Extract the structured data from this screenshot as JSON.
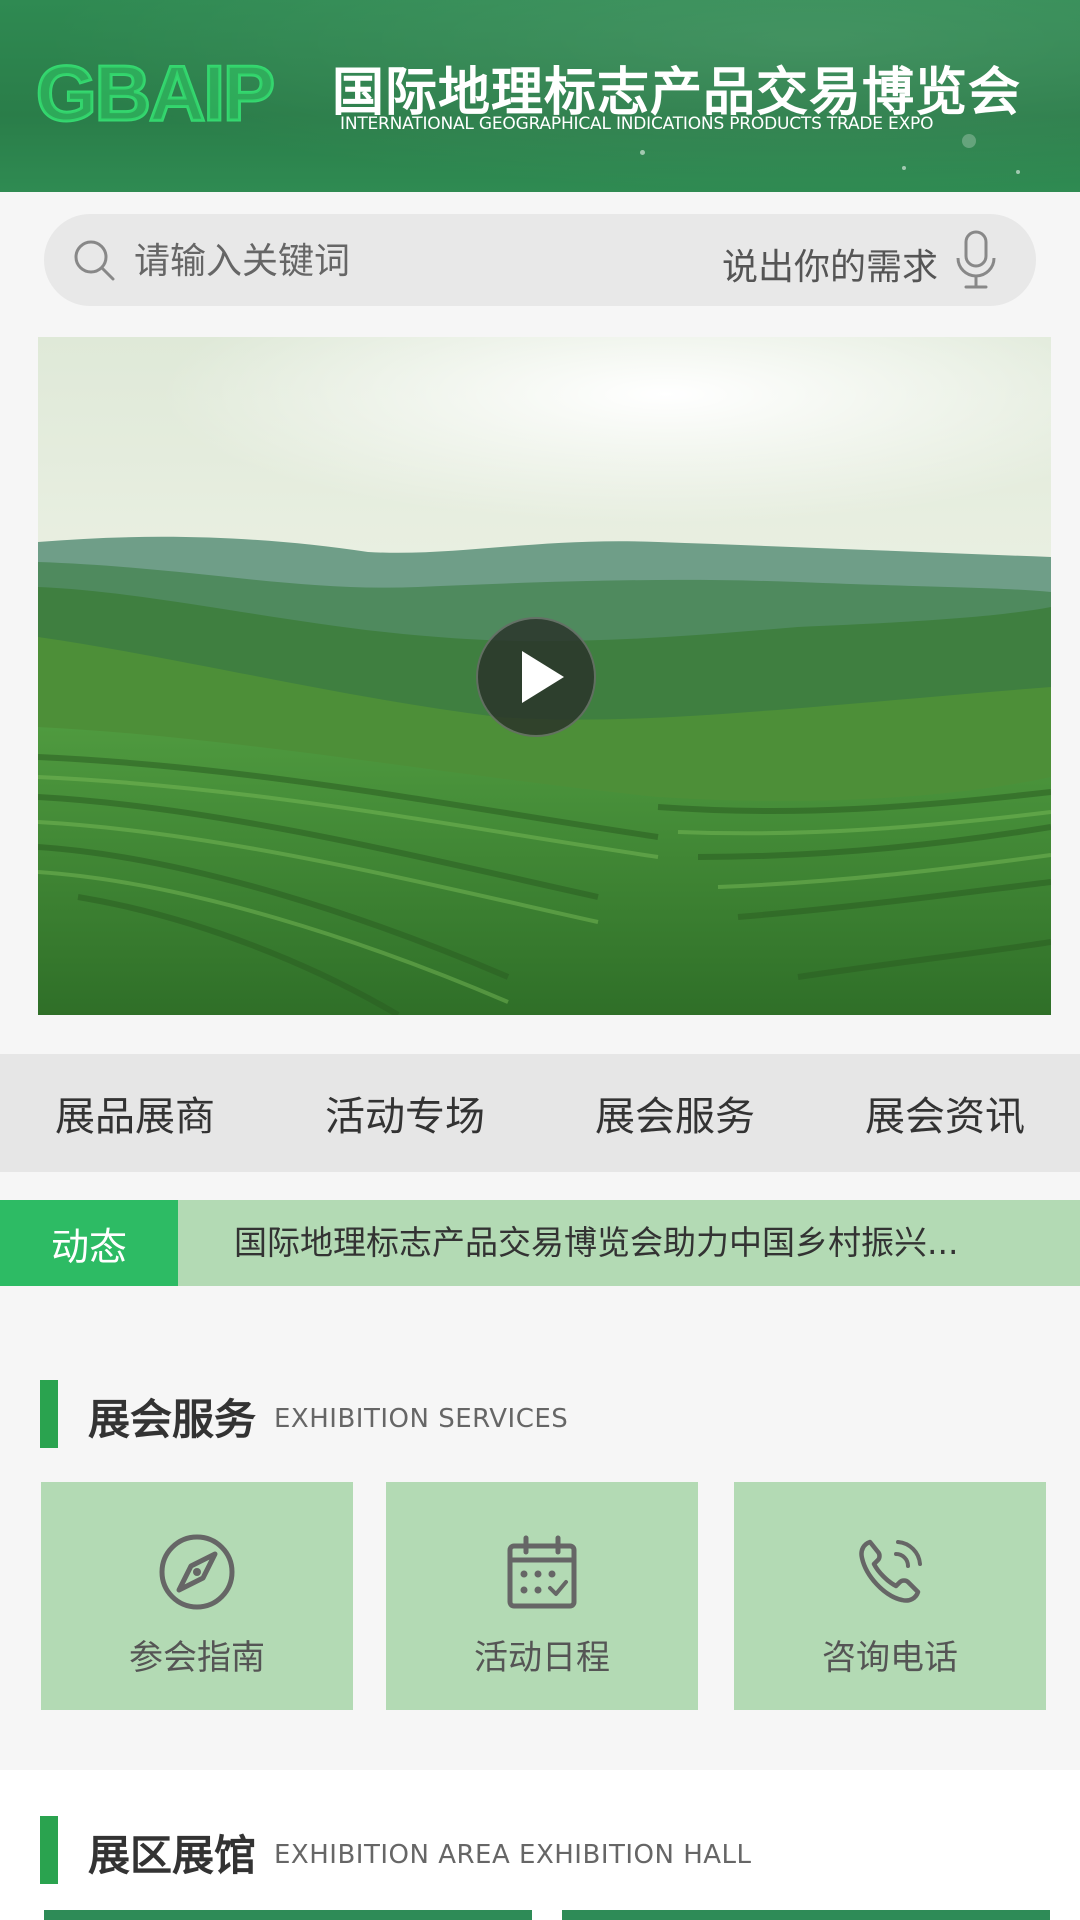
{
  "header": {
    "logo_text": "GBAIP",
    "title": "国际地理标志产品交易博览会",
    "subtitle": "INTERNATIONAL GEOGRAPHICAL INDICATIONS PRODUCTS TRADE EXPO",
    "bg_color": "#2e8552"
  },
  "search": {
    "placeholder": "请输入关键词",
    "voice_label": "说出你的需求",
    "icon": "search-icon",
    "voice_icon": "microphone-icon"
  },
  "hero": {
    "content": "video",
    "play_icon": "play-icon"
  },
  "nav": {
    "items": [
      {
        "label": "展品展商"
      },
      {
        "label": "活动专场"
      },
      {
        "label": "展会服务"
      },
      {
        "label": "展会资讯"
      }
    ]
  },
  "ticker": {
    "tag": "动态",
    "text": "国际地理标志产品交易博览会助力中国乡村振兴...",
    "tag_color": "#2dbb64",
    "bg_color": "#b3dab4"
  },
  "services": {
    "title_cn": "展会服务",
    "title_en": "EXHIBITION SERVICES",
    "cards": [
      {
        "label": "参会指南",
        "icon": "compass-icon"
      },
      {
        "label": "活动日程",
        "icon": "calendar-icon"
      },
      {
        "label": "咨询电话",
        "icon": "phone-icon"
      }
    ],
    "card_color": "#b3dab4"
  },
  "hall": {
    "title_cn": "展区展馆",
    "title_en": "EXHIBITION AREA EXHIBITION HALL"
  },
  "accent_color": "#2aa34f"
}
